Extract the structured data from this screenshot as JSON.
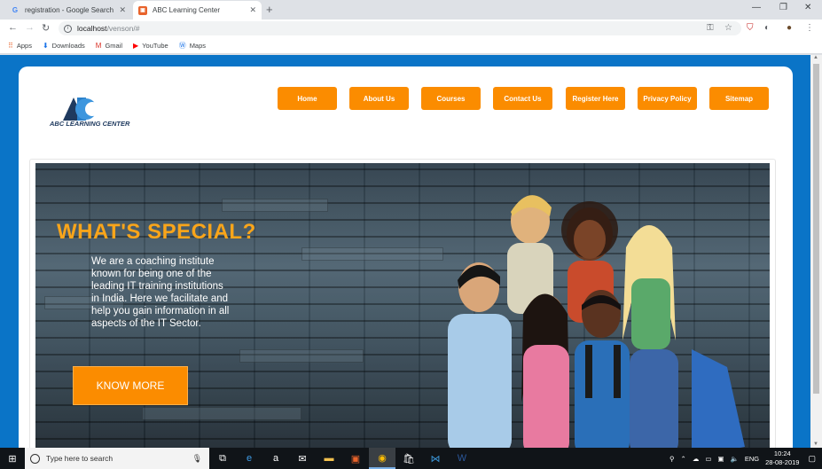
{
  "browser": {
    "tabs": [
      {
        "title": "registration - Google Search",
        "favicon": "G"
      },
      {
        "title": "ABC Learning Center",
        "favicon": "ABC"
      }
    ],
    "new_tab": "+",
    "url_host": "localhost",
    "url_path": "/venson/#",
    "bookmarks": [
      {
        "label": "Apps",
        "icon": "apps-grid-icon"
      },
      {
        "label": "Downloads",
        "icon": "download-icon"
      },
      {
        "label": "Gmail",
        "icon": "gmail-icon"
      },
      {
        "label": "YouTube",
        "icon": "youtube-icon"
      },
      {
        "label": "Maps",
        "icon": "maps-icon"
      }
    ]
  },
  "site": {
    "logo_text": "ABC LEARNING CENTER",
    "menu": [
      "Home",
      "About Us",
      "Courses",
      "Contact Us",
      "Register Here",
      "Privacy Policy",
      "Sitemap"
    ],
    "hero": {
      "headline": "WHAT'S SPECIAL?",
      "intro": "We are a coaching institute known for being one of the leading IT training institutions in India. Here we facilitate and help you gain information in all aspects of the IT Sector.",
      "cta": "KNOW MORE"
    },
    "colors": {
      "brand_blue": "#0a74c7",
      "menu_orange": "#fb8c00",
      "headline_gold": "#f9a51a"
    }
  },
  "taskbar": {
    "search_placeholder": "Type here to search",
    "language": "ENG",
    "time": "10:24",
    "date": "28-08-2019"
  }
}
